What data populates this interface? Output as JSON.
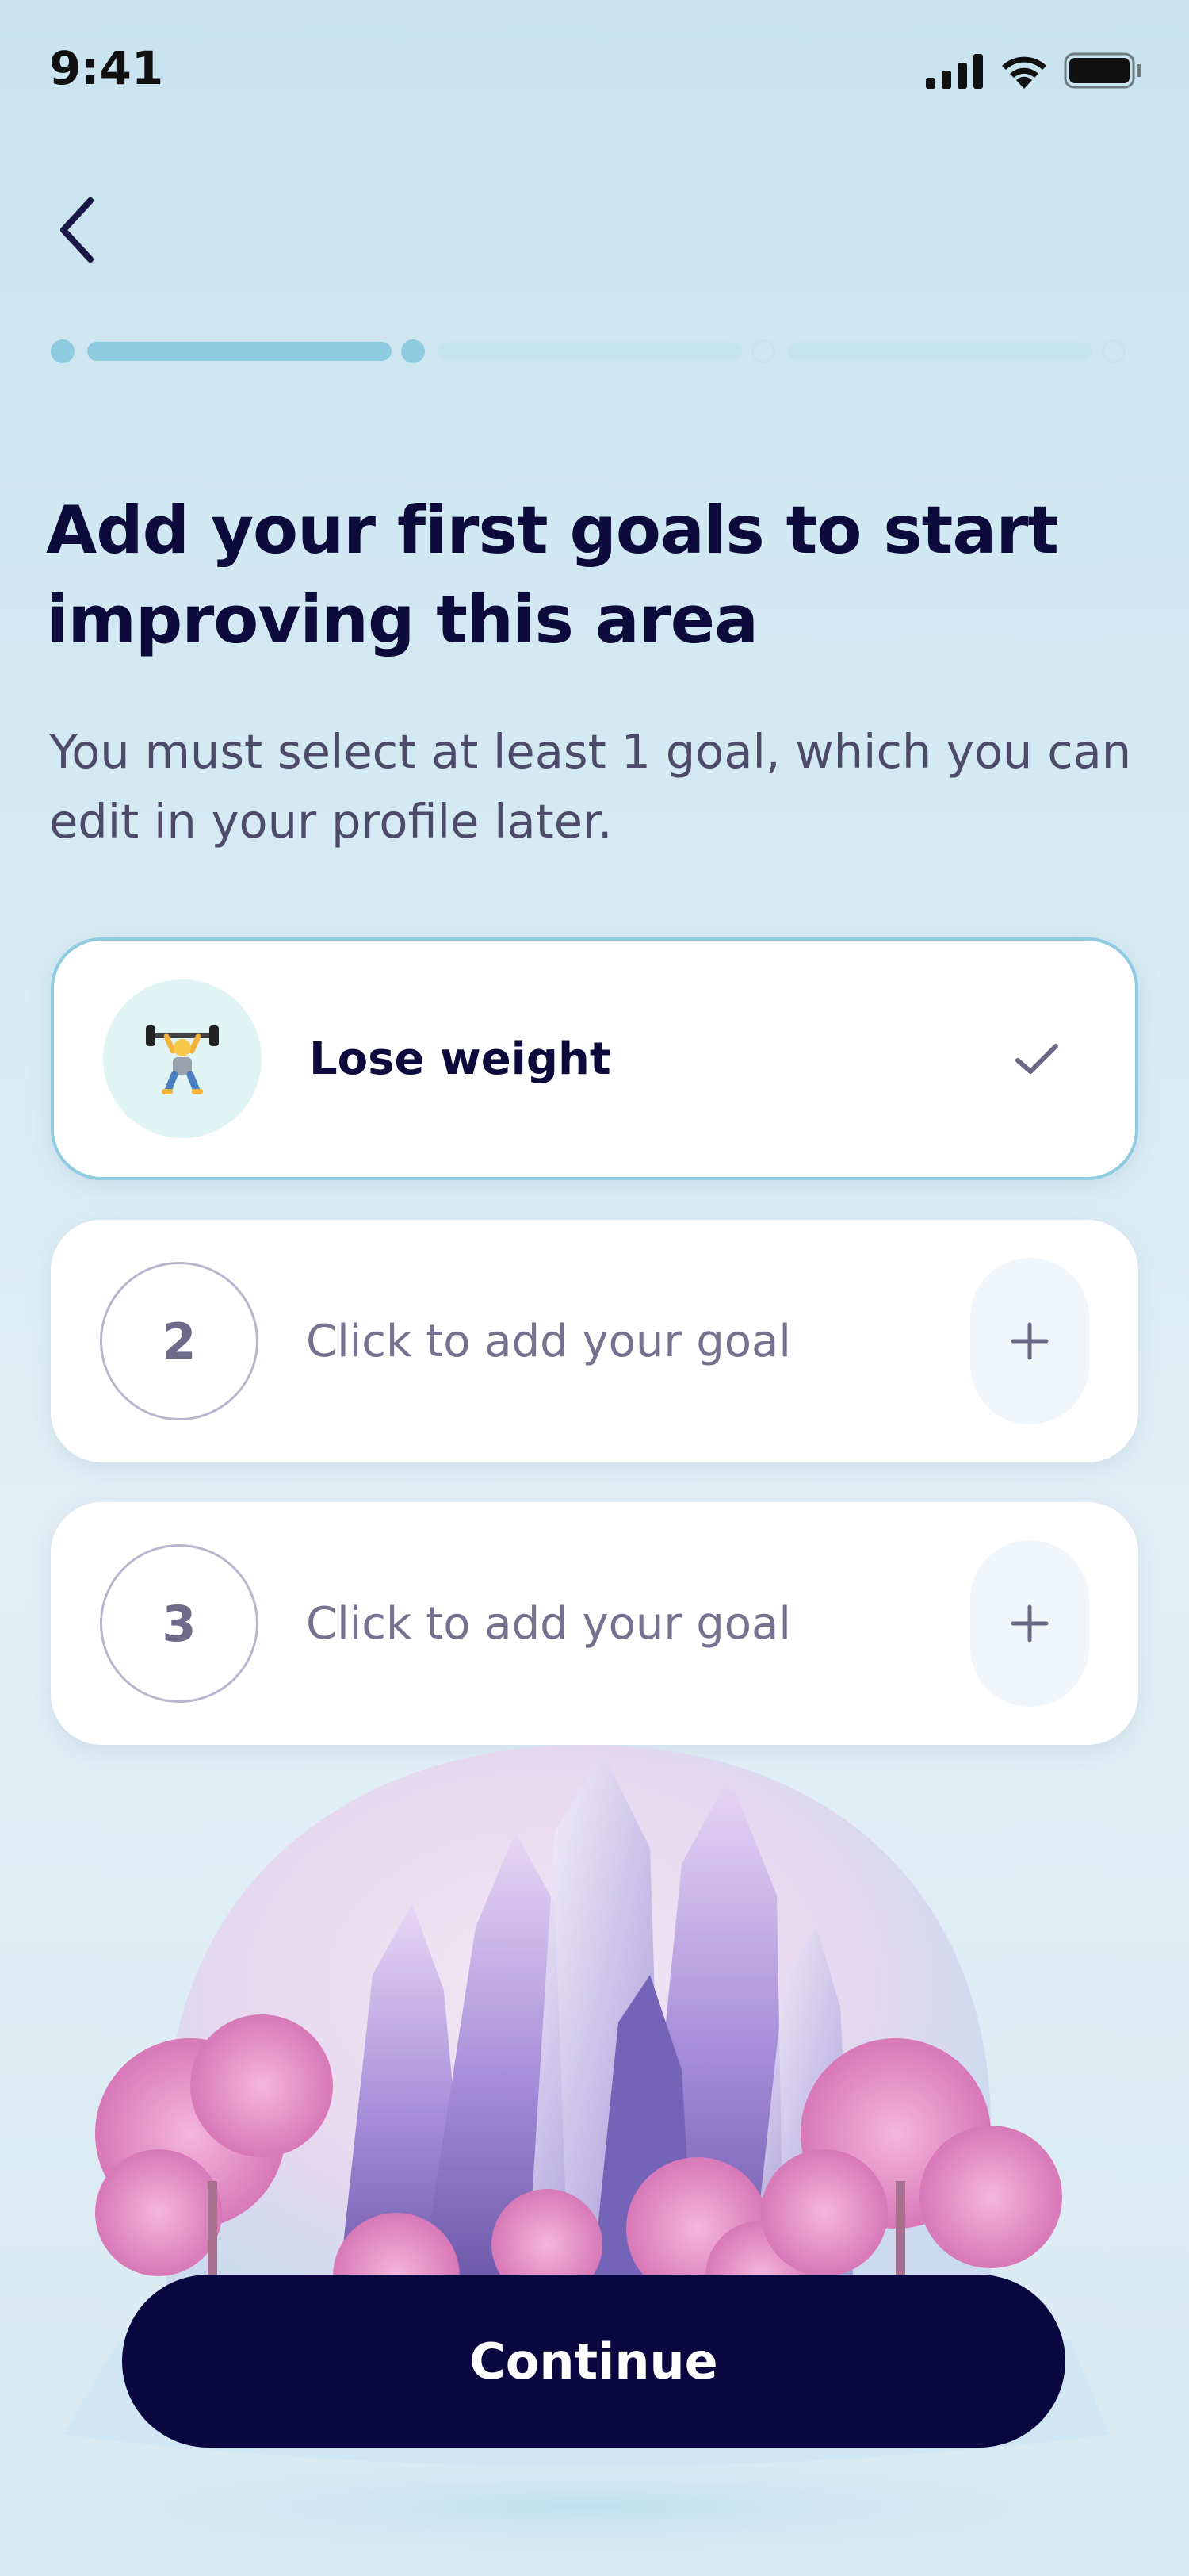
{
  "status_bar": {
    "time": "9:41"
  },
  "progress": {
    "total_steps": 4,
    "completed_steps": 2,
    "colors": {
      "done": "#8fcbe0",
      "pending": "#c6e4f0"
    }
  },
  "page": {
    "title": "Add your first goals to start improving this area",
    "subtitle": "You must select at least 1 goal, which you can edit in your profile later."
  },
  "goals": [
    {
      "label": "Lose weight",
      "icon": "weightlifter-emoji",
      "selected": true
    },
    {
      "number": "2",
      "label": "Click to add your goal",
      "selected": false
    },
    {
      "number": "3",
      "label": "Click to add your goal",
      "selected": false
    }
  ],
  "actions": {
    "continue_label": "Continue"
  },
  "colors": {
    "primary": "#0a0740",
    "selected_border": "#8fcbe0"
  }
}
